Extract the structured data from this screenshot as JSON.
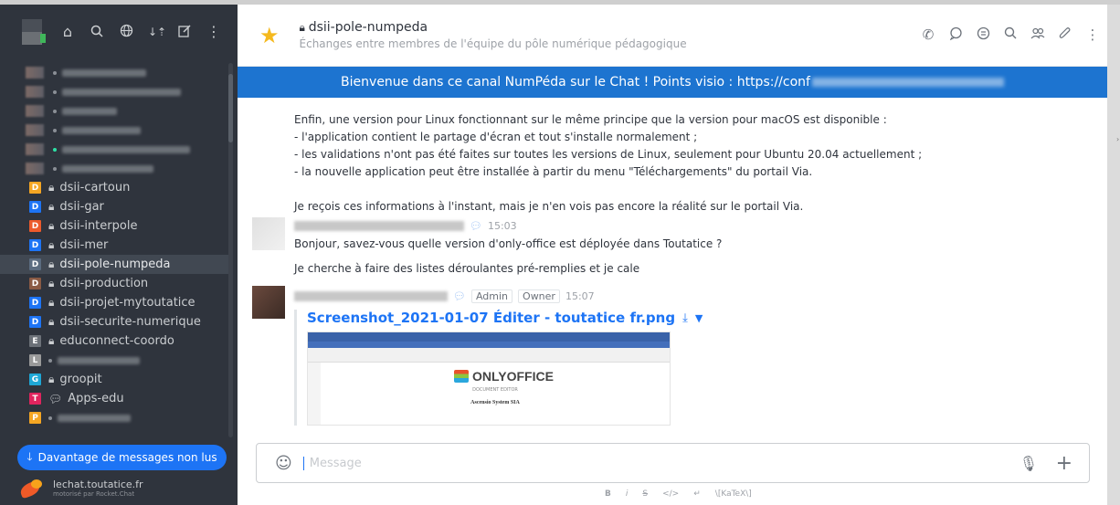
{
  "sidebar": {
    "toolbar_icons": [
      "home-icon",
      "search-icon",
      "directory-icon",
      "sort-icon",
      "create-new-icon",
      "kebab-menu-icon"
    ],
    "channels": [
      {
        "badge": "D",
        "badge_color": "#f5a623",
        "name": "dsii-cartoun",
        "icon": "lock-icon"
      },
      {
        "badge": "D",
        "badge_color": "#1d74f5",
        "name": "dsii-gar",
        "icon": "lock-icon"
      },
      {
        "badge": "D",
        "badge_color": "#ec5a2b",
        "name": "dsii-interpole",
        "icon": "lock-icon"
      },
      {
        "badge": "D",
        "badge_color": "#1d74f5",
        "name": "dsii-mer",
        "icon": "lock-icon"
      },
      {
        "badge": "D",
        "badge_color": "#5b6c80",
        "name": "dsii-pole-numpeda",
        "icon": "lock-icon"
      },
      {
        "badge": "D",
        "badge_color": "#8a5a44",
        "name": "dsii-production",
        "icon": "lock-icon"
      },
      {
        "badge": "D",
        "badge_color": "#1d74f5",
        "name": "dsii-projet-mytoutatice",
        "icon": "lock-icon"
      },
      {
        "badge": "D",
        "badge_color": "#1d74f5",
        "name": "dsii-securite-numerique",
        "icon": "lock-icon"
      },
      {
        "badge": "E",
        "badge_color": "#6c7178",
        "name": "educonnect-coordo",
        "icon": "lock-icon"
      },
      {
        "badge": "L",
        "badge_color": "#9a9a9a",
        "name": "",
        "icon": ""
      },
      {
        "badge": "G",
        "badge_color": "#1ea7d6",
        "name": "groopit",
        "icon": "lock-icon"
      },
      {
        "badge": "T",
        "badge_color": "#e0245e",
        "name": "Apps-edu",
        "icon": "discussion-icon"
      },
      {
        "badge": "P",
        "badge_color": "#f5a623",
        "name": "",
        "icon": ""
      }
    ],
    "unread_button": "Davantage de messages non lus",
    "footer_title": "lechat.toutatice.fr",
    "footer_sub": "motorisé par Rocket.Chat"
  },
  "room": {
    "name": "dsii-pole-numpeda",
    "description": "Échanges entre membres de l'équipe du pôle numérique pédagogique",
    "header_icons": [
      "call-icon",
      "discussion-icon",
      "threads-icon",
      "search-icon",
      "members-icon",
      "attachment-icon",
      "kebab-menu-icon"
    ],
    "announcement": "Bienvenue dans ce canal NumPéda sur le Chat ! Points visio : https://conf"
  },
  "messages": {
    "first_lines": [
      "Enfin, une version pour Linux fonctionnant sur le même principe que la version pour macOS est disponible :",
      "- l'application contient le partage d'écran et tout s'installe normalement ;",
      "- les validations n'ont pas été faites sur toutes les versions de Linux, seulement pour Ubuntu 20.04 actuellement ;",
      "- la nouvelle application peut être installée à partir du menu \"Téléchargements\" du portail Via.",
      "",
      "Je reçois ces informations à l'instant, mais je n'en vois pas encore la réalité sur le portail Via."
    ],
    "second": {
      "time": "15:03",
      "line1": "Bonjour, savez-vous quelle version d'only-office est déployée dans Toutatice ?",
      "line2": "Je cherche à faire des listes déroulantes pré-remplies et je cale"
    },
    "third": {
      "role1": "Admin",
      "role2": "Owner",
      "time": "15:07",
      "attachment_name": "Screenshot_2021-01-07 Éditer - toutatice fr.png",
      "preview": {
        "logo_text": "ONLYOFFICE",
        "sub": "DOCUMENT EDITOR",
        "company": "Ascensio System SIA"
      }
    }
  },
  "composer": {
    "placeholder": "Message",
    "format": [
      "B",
      "i",
      "S",
      "</>",
      "↵",
      "\\[KaTeX\\]"
    ]
  }
}
